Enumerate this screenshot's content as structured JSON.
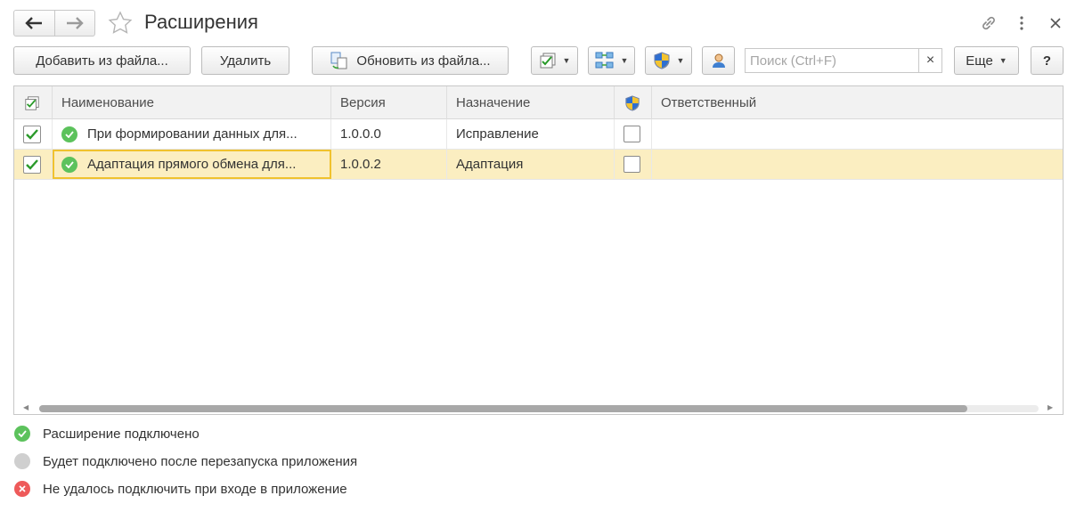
{
  "window": {
    "title": "Расширения",
    "icons": [
      "arrow-left-icon",
      "arrow-right-icon",
      "star-icon",
      "link-icon",
      "more-vertical-icon",
      "close-icon"
    ]
  },
  "toolbar": {
    "add_from_file": "Добавить из файла...",
    "delete": "Удалить",
    "update_from_file": "Обновить из файла...",
    "more": "Еще",
    "help": "?",
    "search_placeholder": "Поиск (Ctrl+F)",
    "search_clear": "×"
  },
  "table": {
    "columns": [
      "Наименование",
      "Версия",
      "Назначение",
      "Ответственный"
    ],
    "rows": [
      {
        "enabled": true,
        "name": "При формировании данных для...",
        "version": "1.0.0.0",
        "purpose": "Исправление",
        "safe_mode": false,
        "responsible": "",
        "status": "connected"
      },
      {
        "enabled": true,
        "name": "Адаптация прямого обмена для...",
        "version": "1.0.0.2",
        "purpose": "Адаптация",
        "safe_mode": false,
        "responsible": "",
        "status": "connected",
        "selected": true
      }
    ]
  },
  "legend": {
    "items": [
      {
        "label": "Расширение подключено",
        "color": "#5cc25c"
      },
      {
        "label": "Будет подключено после перезапуска приложения",
        "color": "#cfcfcf"
      },
      {
        "label": "Не удалось подключить при входе в приложение",
        "color": "#ee5a5a"
      }
    ]
  },
  "colors": {
    "selected_row": "#fbeec1",
    "focus_border": "#f0c22e",
    "check_green": "#2a9a2a"
  }
}
